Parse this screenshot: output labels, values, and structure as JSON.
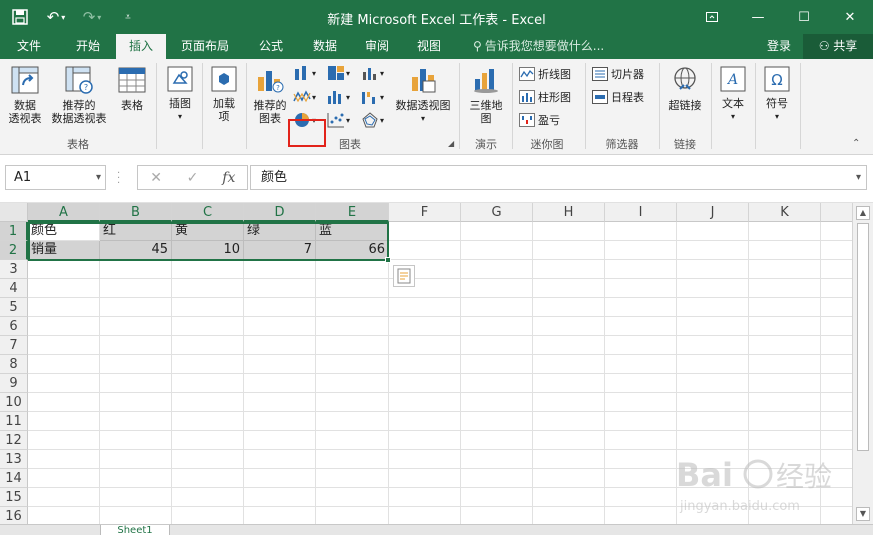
{
  "window": {
    "title": "新建 Microsoft Excel 工作表 - Excel"
  },
  "tabs": [
    {
      "label": "文件"
    },
    {
      "label": "开始"
    },
    {
      "label": "插入"
    },
    {
      "label": "页面布局"
    },
    {
      "label": "公式"
    },
    {
      "label": "数据"
    },
    {
      "label": "审阅"
    },
    {
      "label": "视图"
    }
  ],
  "tellme": "告诉我您想要做什么...",
  "account": {
    "login": "登录",
    "share": "共享"
  },
  "ribbon": {
    "tables": {
      "pivot": "数据\n透视表",
      "recommended_pivot": "推荐的\n数据透视表",
      "table": "表格",
      "group": "表格"
    },
    "illustrations": {
      "label": "插图"
    },
    "addins": {
      "label": "加载\n项"
    },
    "charts": {
      "recommended": "推荐的\n图表",
      "pivot_chart": "数据透视图",
      "group": "图表"
    },
    "tours": {
      "map3d": "三维地\n图",
      "group": "演示"
    },
    "sparklines": {
      "line": "折线图",
      "column": "柱形图",
      "winloss": "盈亏",
      "group": "迷你图"
    },
    "filters": {
      "slicer": "切片器",
      "timeline": "日程表",
      "group": "筛选器"
    },
    "links": {
      "hyperlink": "超链接",
      "group": "链接"
    },
    "text": {
      "label": "文本"
    },
    "symbols": {
      "label": "符号"
    }
  },
  "formula_bar": {
    "name_box": "A1",
    "fx": "fx",
    "content": "颜色"
  },
  "columns": [
    "A",
    "B",
    "C",
    "D",
    "E",
    "F",
    "G",
    "H",
    "I",
    "J",
    "K"
  ],
  "rows": [
    "1",
    "2",
    "3",
    "4",
    "5",
    "6",
    "7",
    "8",
    "9",
    "10",
    "11",
    "12",
    "13",
    "14",
    "15",
    "16"
  ],
  "cells": {
    "row1": [
      "颜色",
      "红",
      "黄",
      "绿",
      "蓝"
    ],
    "row2": [
      "销量",
      "45",
      "10",
      "7",
      "66"
    ]
  },
  "sheet": {
    "tab": "Sheet1"
  },
  "watermark": {
    "line1": "Bai 经验",
    "line2": "jingyan.baidu.com"
  },
  "colors": {
    "accent": "#217346",
    "highlight": "#e2231a"
  }
}
